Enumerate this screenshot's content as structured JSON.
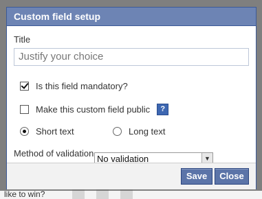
{
  "background": {
    "bottom_text": "like to win?"
  },
  "dialog": {
    "title": "Custom field setup",
    "title_label": "Title",
    "title_value": "Justify your choice",
    "mandatory_label": "Is this field mandatory?",
    "mandatory_checked": true,
    "public_label": "Make this custom field public",
    "public_checked": false,
    "help_glyph": "?",
    "answer_type": {
      "short_label": "Short text",
      "long_label": "Long text",
      "selected": "short"
    },
    "validation_label": "Method of validation",
    "validation_value": "No validation",
    "save_label": "Save",
    "close_label": "Close"
  },
  "colors": {
    "titlebar": "#6d84b4",
    "button": "#5b74a8",
    "help_icon": "#3d67b1"
  }
}
